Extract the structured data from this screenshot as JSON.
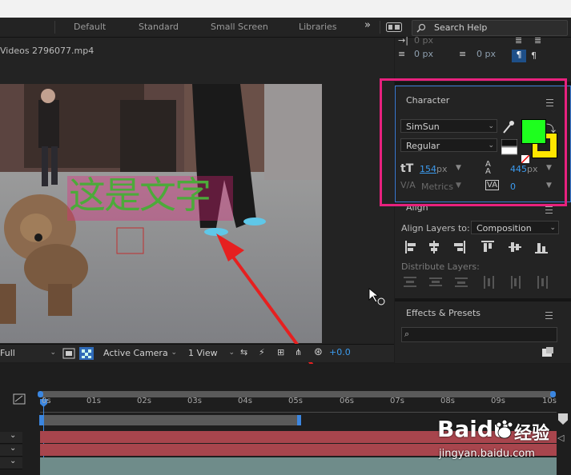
{
  "workspace": {
    "tabs": [
      "Default",
      "Standard",
      "Small Screen",
      "Libraries"
    ],
    "overflow_icon": "double-chevron-right-icon",
    "search_placeholder": "Search Help"
  },
  "composition": {
    "file_name": "Videos 2796077.mp4",
    "overlay_text": "这是文字",
    "overlay_text_color": "#4caa3a"
  },
  "viewer_bar": {
    "resolution": "Full",
    "camera": "Active Camera",
    "views": "1 View",
    "exposure": "+0.0"
  },
  "paragraph_snippet": {
    "indent_values": [
      "0 px",
      "0 px",
      "0 px"
    ]
  },
  "character": {
    "title": "Character",
    "font_family": "SimSun",
    "font_style": "Regular",
    "font_size": "154",
    "font_size_unit": "px",
    "leading": "445",
    "leading_unit": "px",
    "kerning": "Metrics",
    "tracking": "0",
    "fill_color": "#1eff1e",
    "stroke_color": "#ffe600",
    "highlight_color": "#e8217e"
  },
  "align": {
    "title": "Align",
    "align_layers_to_label": "Align Layers to:",
    "align_layers_to_value": "Composition",
    "distribute_label": "Distribute Layers:"
  },
  "effects": {
    "title": "Effects & Presets"
  },
  "timeline": {
    "ticks": [
      "0s",
      "01s",
      "02s",
      "03s",
      "04s",
      "05s",
      "06s",
      "07s",
      "08s",
      "09s",
      "10s"
    ]
  },
  "watermark": {
    "brand": "Baidu",
    "brand_cn": "经验",
    "url": "jingyan.baidu.com"
  }
}
